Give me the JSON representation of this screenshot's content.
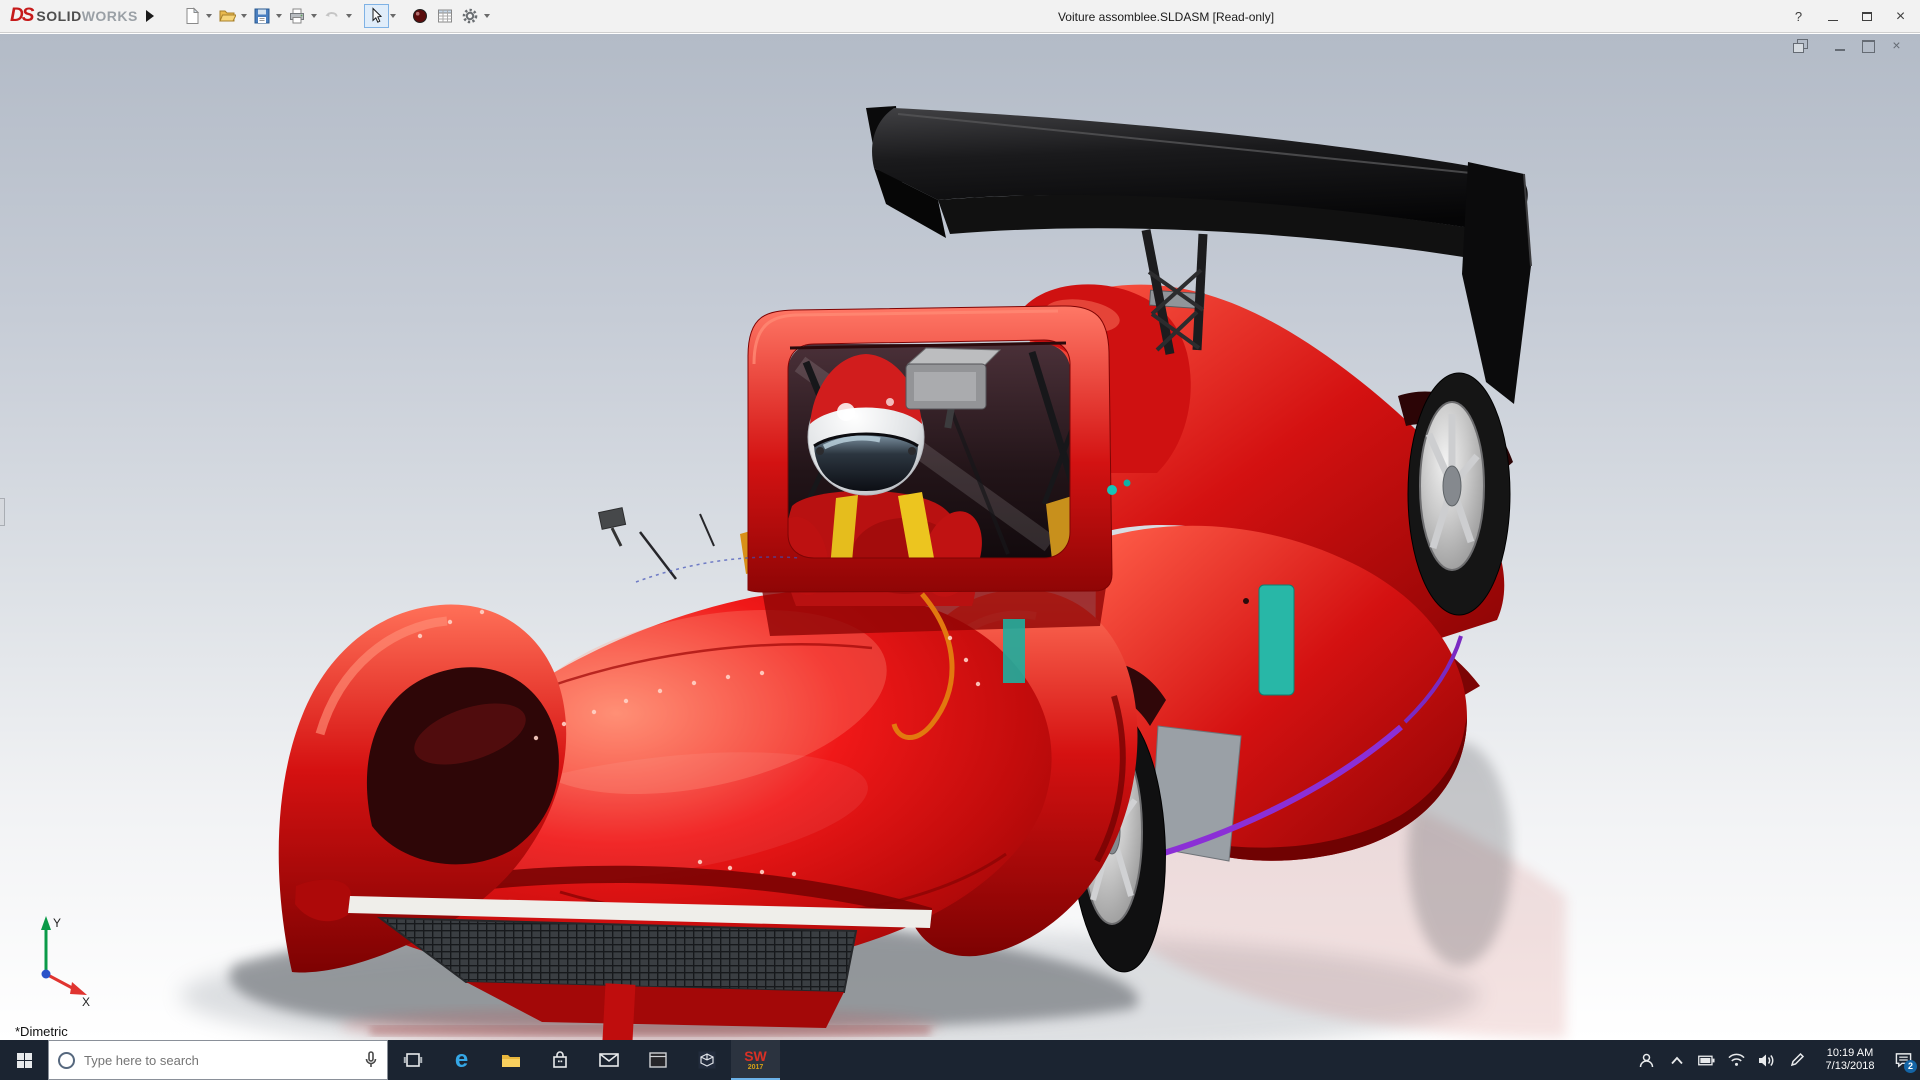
{
  "titlebar": {
    "logo": {
      "mark": "DS",
      "solid": "SOLID",
      "works": "WORKS"
    },
    "title": "Voiture assomblee.SLDASM [Read-only]",
    "help_glyph": "?",
    "close_glyph": "×",
    "toolbar_items": [
      {
        "name": "new-document",
        "dropdown": true
      },
      {
        "name": "open",
        "dropdown": true
      },
      {
        "name": "save",
        "dropdown": true
      },
      {
        "name": "print",
        "dropdown": true
      },
      {
        "name": "undo",
        "dropdown": true,
        "disabled": true
      },
      {
        "name": "select-cursor",
        "dropdown": true,
        "active": true
      },
      {
        "name": "appearance-sphere",
        "dropdown": false
      },
      {
        "name": "design-table",
        "dropdown": false
      },
      {
        "name": "options-gear",
        "dropdown": true
      }
    ]
  },
  "viewport": {
    "view_label": "*Dimetric",
    "triad": {
      "x_label": "X",
      "y_label": "Y"
    },
    "child_controls": [
      "window-restore",
      "window-minimize",
      "window-maximize",
      "window-close"
    ]
  },
  "taskbar": {
    "search": {
      "placeholder": "Type here to search"
    },
    "apps": [
      "task-view",
      "edge",
      "file-explorer",
      "store",
      "mail",
      "console",
      "cad-viewer",
      "solidworks-2017"
    ],
    "edge_glyph": "e",
    "sw_icon": {
      "text": "SW",
      "year": "2017"
    },
    "tray": [
      "people",
      "hidden-icons",
      "battery",
      "network",
      "volume",
      "pen",
      "clock",
      "action-center"
    ],
    "clock": {
      "time": "10:19 AM",
      "date": "7/13/2018"
    },
    "action_badge": "2"
  },
  "colors": {
    "car_red": "#d81212",
    "accent_teal": "#28b7a7",
    "accent_purple": "#8b2fd6",
    "wing_black": "#0b0b0c",
    "taskbar_bg": "#1b2431",
    "titlebar_bg": "#f2f2f2"
  }
}
